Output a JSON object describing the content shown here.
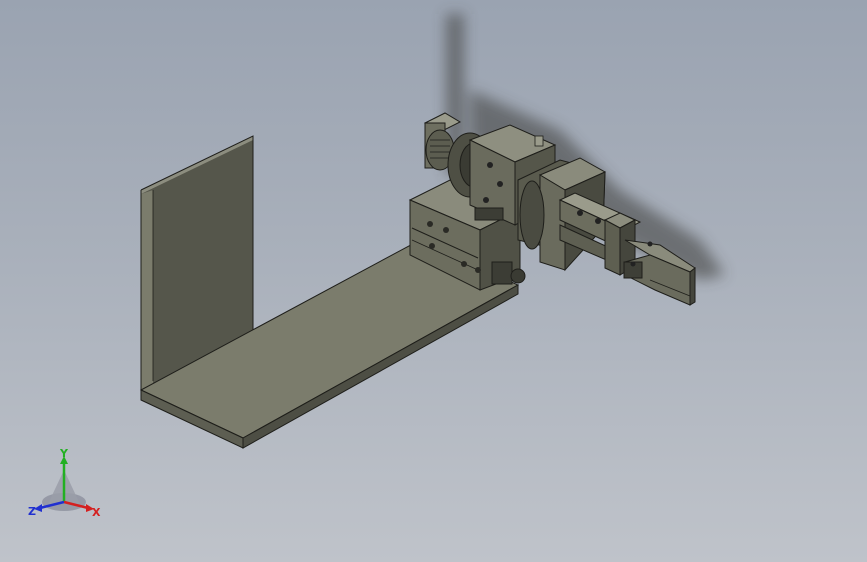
{
  "viewport": {
    "background_top": "#9aa3b1",
    "background_bottom": "#bfc3ca",
    "model_color": "#6f705f"
  },
  "triad": {
    "x_label": "X",
    "y_label": "Y",
    "z_label": "Z",
    "x_color": "#d42020",
    "y_color": "#22b022",
    "z_color": "#2030d0"
  }
}
